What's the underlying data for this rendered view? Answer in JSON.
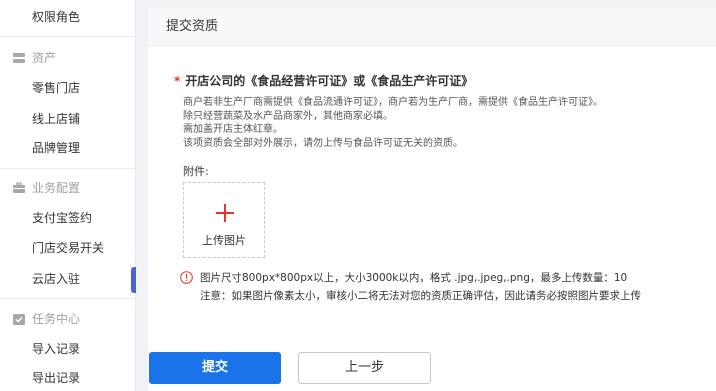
{
  "sidebar": {
    "items": [
      {
        "label": "权限角色"
      },
      {
        "group": "资产",
        "icon": "database-icon"
      },
      {
        "label": "零售门店"
      },
      {
        "label": "线上店铺"
      },
      {
        "label": "品牌管理"
      },
      {
        "group": "业务配置",
        "icon": "briefcase-icon"
      },
      {
        "label": "支付宝签约"
      },
      {
        "label": "门店交易开关"
      },
      {
        "label": "云店入驻",
        "active": true
      },
      {
        "group": "任务中心",
        "icon": "task-check-icon"
      },
      {
        "label": "导入记录"
      },
      {
        "label": "导出记录"
      }
    ]
  },
  "panel": {
    "title": "提交资质",
    "required_star": "*",
    "license_title": "开店公司的《食品经营许可证》或《食品生产许可证》",
    "description": [
      "商户若非生产厂商需提供《食品流通许可证》，商户若为生产厂商，需提供《食品生产许可证》。",
      "除只经营蔬菜及水产品商家外，其他商家必填。",
      "需加盖开店主体红章。",
      "该项资质会全部对外展示，请勿上传与食品许可证无关的资质。"
    ],
    "attachment_label": "附件:",
    "upload_label": "上传图片",
    "notice_lines": [
      "图片尺寸800px*800px以上，大小3000k以内，格式 .jpg,.jpeg,.png，最多上传数量：10",
      "注意：如果图片像素太小，审核小二将无法对您的资质正确评估，因此请务必按照图片要求上传"
    ]
  },
  "buttons": {
    "submit": "提交",
    "previous": "上一步"
  },
  "colors": {
    "accent": "#1a73e8",
    "required": "#e8342c",
    "active_marker": "#4f63cf",
    "upload_plus": "#e8342c",
    "info_icon": "#e8342c"
  }
}
